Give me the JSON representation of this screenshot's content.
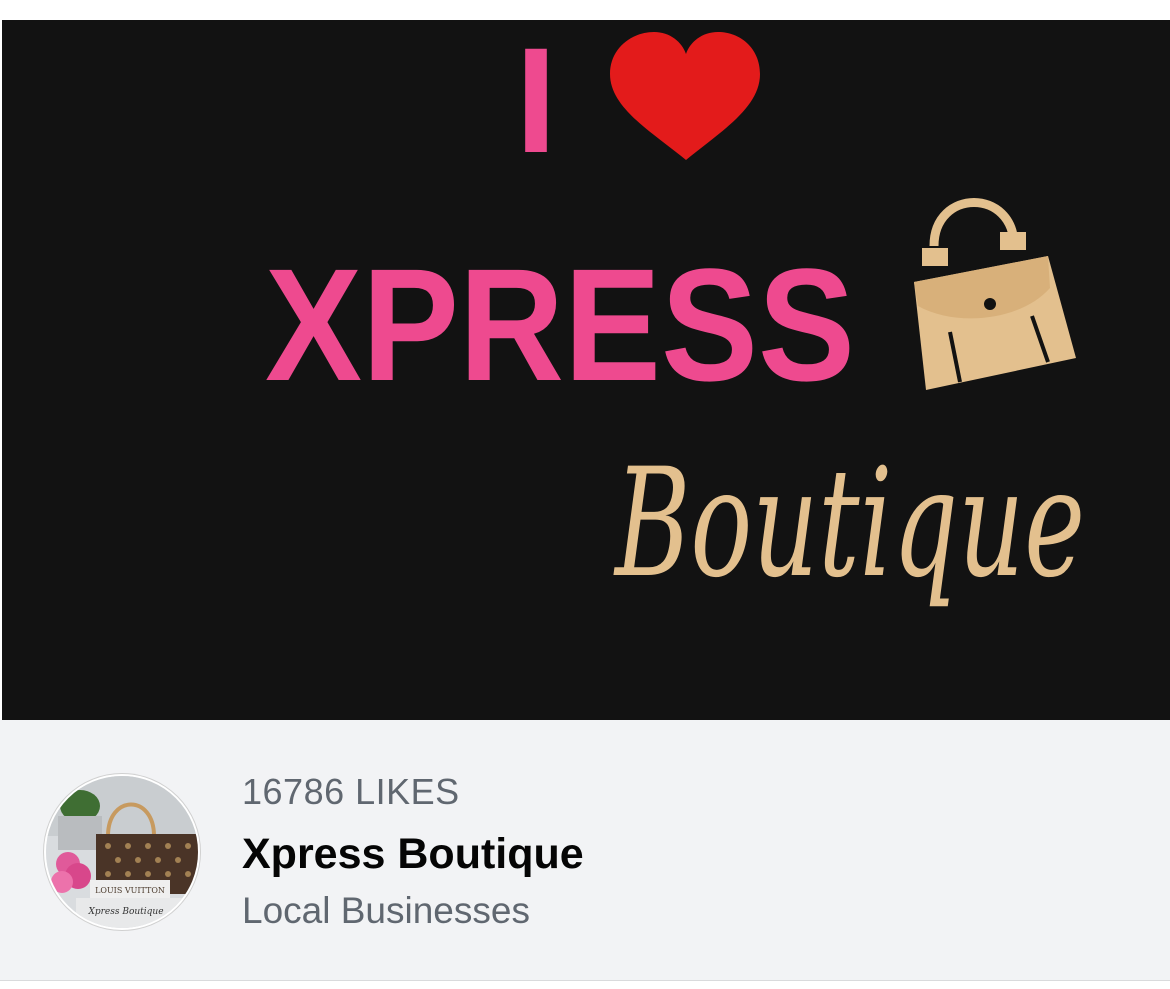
{
  "cover": {
    "line1_letter": "I",
    "line2_word": "XPRESS",
    "line3_word": "Boutique",
    "icons": [
      "heart-icon",
      "handbag-icon"
    ],
    "colors": {
      "background": "#121212",
      "pink": "#ee4a8f",
      "heart_red": "#e31b1b",
      "tan": "#e3c08e"
    }
  },
  "page": {
    "likes": "16786 LIKES",
    "name": "Xpress Boutique",
    "category": "Local Businesses",
    "avatar": {
      "icon": "profile-photo",
      "bag_label": "LOUIS VUITTON",
      "signature": "Xpress Boutique"
    }
  }
}
